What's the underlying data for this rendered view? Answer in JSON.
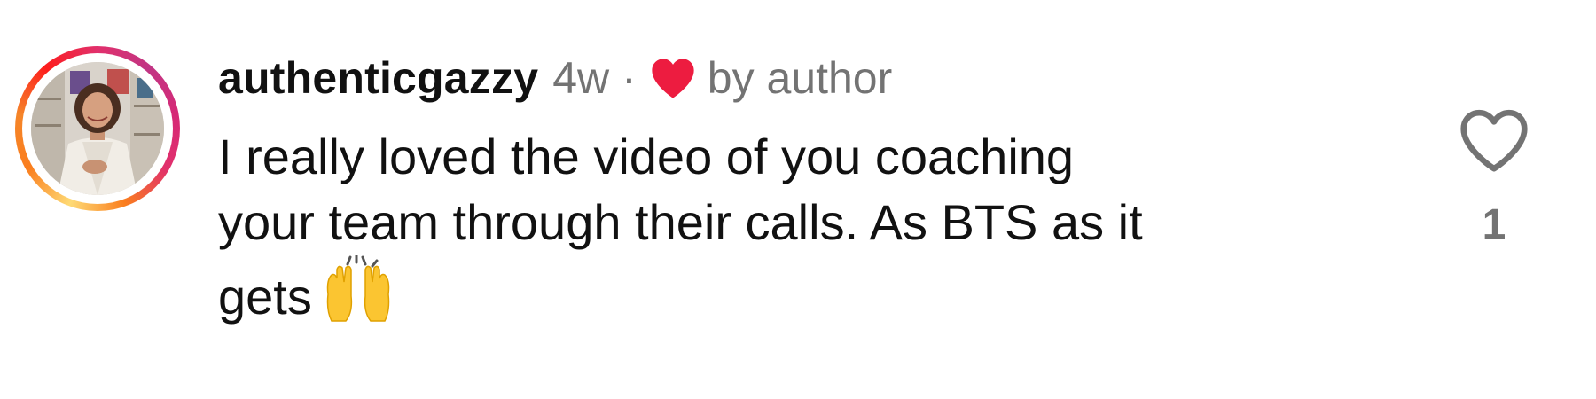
{
  "comment": {
    "username": "authenticgazzy",
    "time_ago": "4w",
    "separator": "·",
    "author_like_label": "by author",
    "text_lines": [
      "I really loved the video of you coaching",
      "your team through their calls. As BTS as it",
      "gets"
    ],
    "emoji": "raising-hands",
    "like_count": "1"
  },
  "colors": {
    "author_heart": "#ed1c40",
    "muted_text": "#737373",
    "like_outline": "#737373",
    "ring_gradient": [
      "#feda75",
      "#fa7e1e",
      "#e1306c",
      "#c13584"
    ]
  },
  "icons": {
    "author_heart": "heart-filled-icon",
    "like": "heart-outline-icon",
    "emoji": "raising-hands-emoji"
  }
}
